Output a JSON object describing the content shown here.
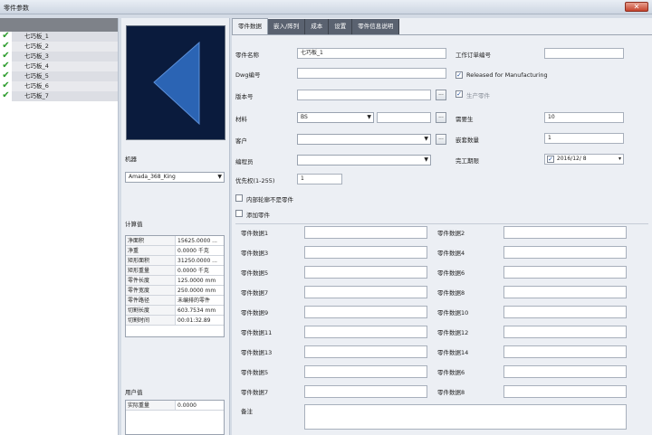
{
  "window": {
    "title": "零件参数",
    "close_glyph": "✕"
  },
  "parts_list": {
    "check_glyph": "✔",
    "items": [
      "七巧板_1",
      "七巧板_2",
      "七巧板_3",
      "七巧板_4",
      "七巧板_5",
      "七巧板_6",
      "七巧板_7"
    ]
  },
  "preview": {
    "background": "#0a1b3d",
    "shape_color": "#2b64b4"
  },
  "machine": {
    "label": "机器",
    "value": "Amada_368_King"
  },
  "calc": {
    "label": "计算值",
    "rows": [
      {
        "k": "净面积",
        "v": "15625.0000 ..."
      },
      {
        "k": "净重",
        "v": "0.0000 千克"
      },
      {
        "k": "矩形面积",
        "v": "31250.0000 ..."
      },
      {
        "k": "矩形重量",
        "v": "0.0000 千克"
      },
      {
        "k": "零件长度",
        "v": "125.0000 mm"
      },
      {
        "k": "零件宽度",
        "v": "250.0000 mm"
      },
      {
        "k": "零件路径",
        "v": "未编排的零件"
      },
      {
        "k": "切割长度",
        "v": "603.7534 mm"
      },
      {
        "k": "切割时间",
        "v": "00:01:32.89"
      }
    ]
  },
  "user": {
    "label": "用户值",
    "rows": [
      {
        "k": "实际重量",
        "v": "0.0000"
      }
    ]
  },
  "tabs": [
    "零件数据",
    "嵌入/阵列",
    "成本",
    "设置",
    "零件信息说明"
  ],
  "form": {
    "part_name_label": "零件名称",
    "part_name": "七巧板_1",
    "dwg_label": "Dwg编号",
    "dwg": "",
    "rev_label": "版本号",
    "rev": "",
    "material_label": "材料",
    "material": "BS",
    "thickness": "",
    "customer_label": "客户",
    "customer": "",
    "drawer_label": "编程员",
    "drawer": "",
    "priority_label": "优先权(1-255)",
    "priority": "1",
    "order_label": "工作订单编号",
    "order": "",
    "released_label": "Released for Manufacturing",
    "produce_label": "生产零件",
    "qty_label": "需要生",
    "qty": "10",
    "nest_qty_label": "嵌套数量",
    "nest_qty": "1",
    "due_label": "完工期限",
    "due": "2016/12/ 8",
    "cb_inner_label": "内部轮廓不是零件",
    "cb_other_label": "添加零件",
    "ellipsis": "...",
    "user_fields": [
      "零件数据1",
      "零件数据2",
      "零件数据3",
      "零件数据4",
      "零件数据5",
      "零件数据6",
      "零件数据7",
      "零件数据8",
      "零件数据9",
      "零件数据10",
      "零件数据11",
      "零件数据12",
      "零件数据13",
      "零件数据14",
      "零件数据5",
      "零件数据6",
      "零件数据7",
      "零件数据8"
    ],
    "notes_label": "备注"
  }
}
